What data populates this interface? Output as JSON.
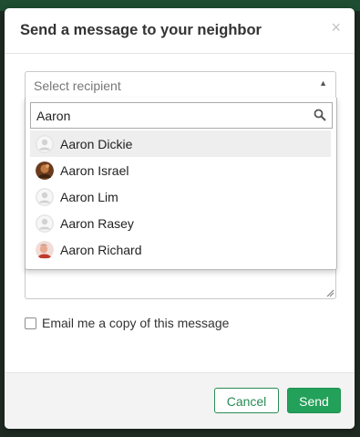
{
  "modal": {
    "title": "Send a message to your neighbor",
    "close_glyph": "×"
  },
  "recipient_select": {
    "placeholder": "Select recipient",
    "arrow_glyph": "▲"
  },
  "search": {
    "value": "Aaron",
    "icon": "search-icon"
  },
  "results": [
    {
      "name": "Aaron Dickie",
      "avatar": "default-avatar",
      "highlighted": true
    },
    {
      "name": "Aaron Israel",
      "avatar": "photo-avatar",
      "highlighted": false
    },
    {
      "name": "Aaron Lim",
      "avatar": "default-avatar",
      "highlighted": false
    },
    {
      "name": "Aaron Rasey",
      "avatar": "default-avatar",
      "highlighted": false
    },
    {
      "name": "Aaron Richard",
      "avatar": "photo-avatar",
      "highlighted": false
    }
  ],
  "copy_option": {
    "label": "Email me a copy of this message",
    "checked": false
  },
  "footer": {
    "cancel_label": "Cancel",
    "send_label": "Send"
  },
  "colors": {
    "accent": "#23a05a",
    "accent_border": "#2a8a55",
    "backdrop": "#1f2a23"
  }
}
